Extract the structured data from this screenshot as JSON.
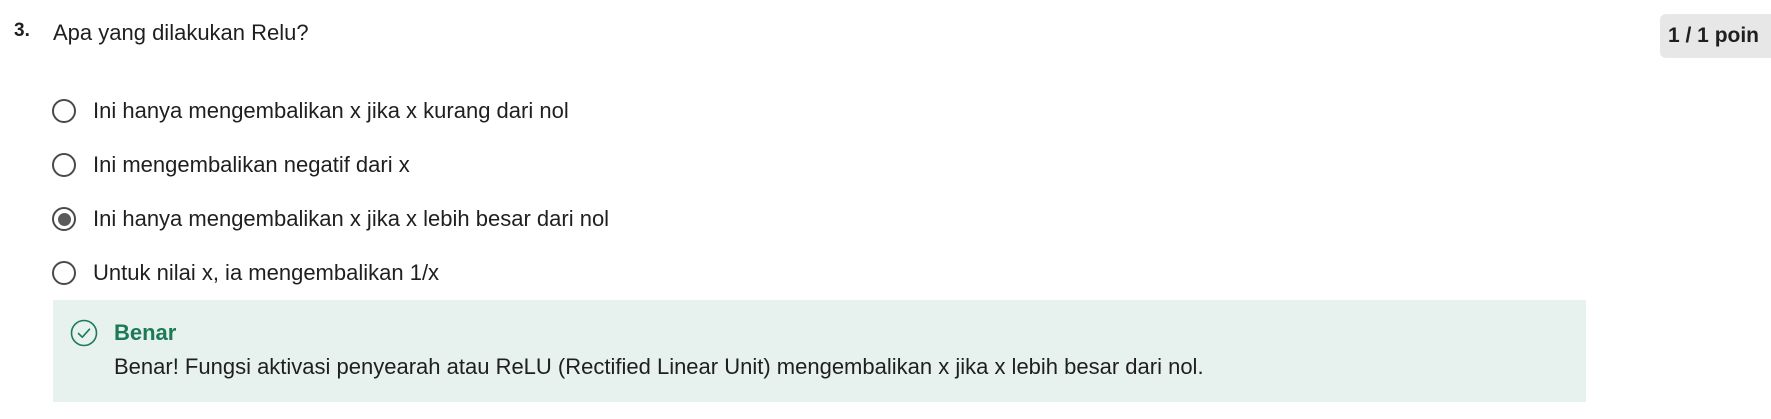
{
  "question": {
    "number": "3.",
    "text": "Apa yang dilakukan Relu?",
    "score": "1 / 1 poin"
  },
  "options": [
    {
      "label": "Ini hanya mengembalikan x jika x kurang dari nol",
      "selected": false
    },
    {
      "label": "Ini mengembalikan negatif dari x",
      "selected": false
    },
    {
      "label": "Ini hanya mengembalikan x jika x lebih besar dari nol",
      "selected": true
    },
    {
      "label": "Untuk nilai x, ia mengembalikan 1/x",
      "selected": false
    }
  ],
  "feedback": {
    "icon": "check-circle-icon",
    "title": "Benar",
    "text": "Benar! Fungsi aktivasi penyearah atau ReLU (Rectified Linear Unit) mengembalikan x jika x lebih besar dari nol.",
    "accent_color": "#1c7a57",
    "background_color": "#e7f1ed"
  }
}
